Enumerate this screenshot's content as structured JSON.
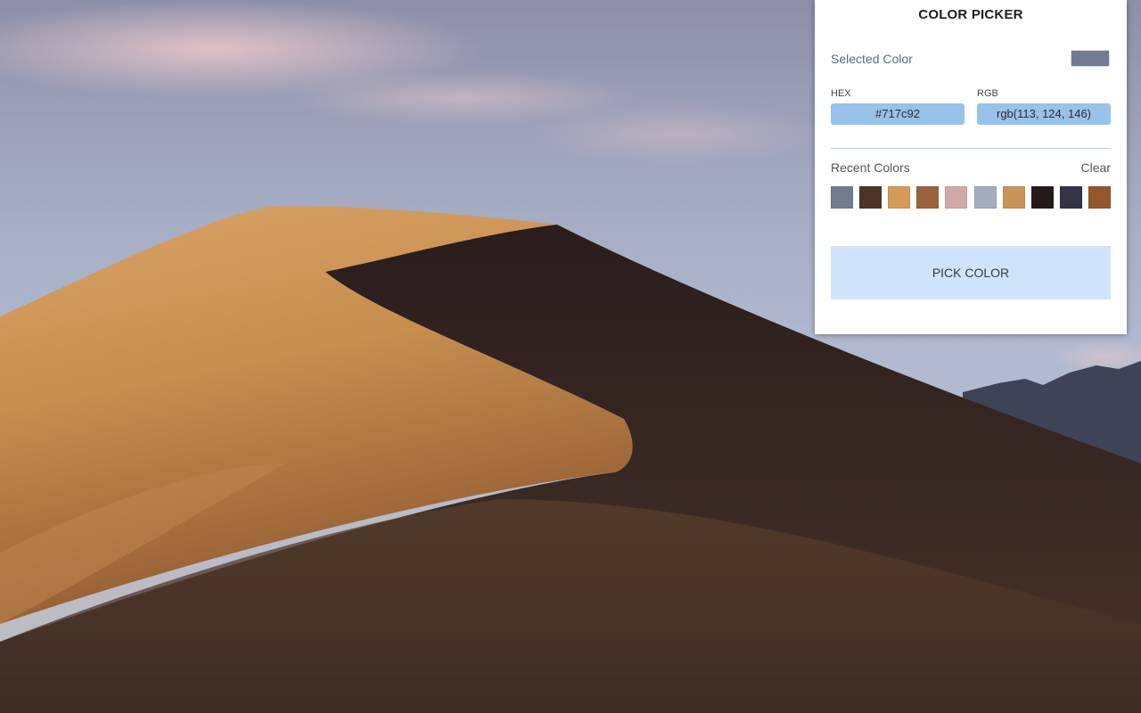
{
  "panel": {
    "title": "COLOR PICKER",
    "selected_label": "Selected Color",
    "selected_color": "#717c92",
    "hex_label": "HEX",
    "hex_value": "#717c92",
    "rgb_label": "RGB",
    "rgb_value": "rgb(113, 124, 146)",
    "recent_label": "Recent Colors",
    "clear_label": "Clear",
    "recent_colors": [
      "#717c92",
      "#4a3526",
      "#d39a5a",
      "#9b633d",
      "#d2a8a6",
      "#a4adbd",
      "#c9935a",
      "#24191b",
      "#333447",
      "#93572b"
    ],
    "pick_button_label": "PICK COLOR"
  },
  "colors": {
    "panel_bg": "#ffffff",
    "input_bg": "#97c2ea",
    "button_bg": "#cfe4fa",
    "divider": "#a9d2ec"
  }
}
